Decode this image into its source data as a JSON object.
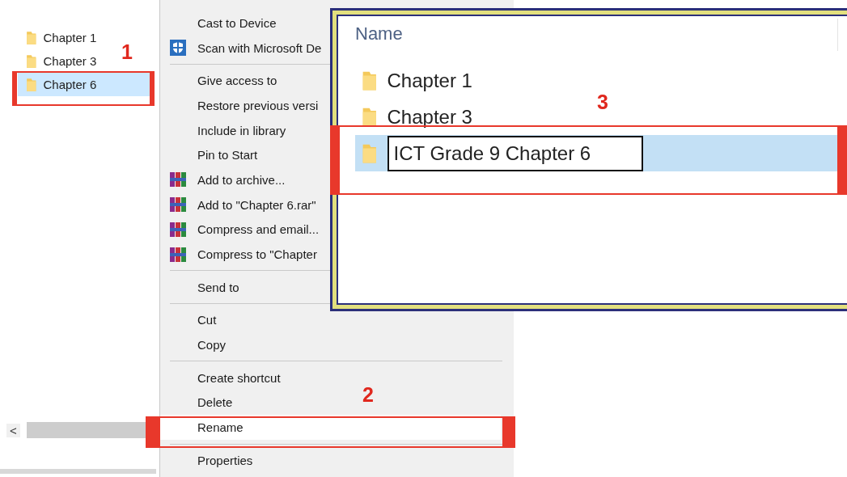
{
  "left_pane": {
    "items": [
      {
        "label": "Chapter 1",
        "selected": false
      },
      {
        "label": "Chapter 3",
        "selected": false
      },
      {
        "label": "Chapter 6",
        "selected": true
      }
    ],
    "scroll_left": "<"
  },
  "context_menu": {
    "items": [
      {
        "kind": "item",
        "label": "Cast to Device"
      },
      {
        "kind": "scan",
        "label": "Scan with Microsoft De"
      },
      {
        "kind": "separator"
      },
      {
        "kind": "item",
        "label": "Give access to"
      },
      {
        "kind": "item",
        "label": "Restore previous versi"
      },
      {
        "kind": "item",
        "label": "Include in library"
      },
      {
        "kind": "item",
        "label": "Pin to Start"
      },
      {
        "kind": "archive",
        "label": "Add to archive..."
      },
      {
        "kind": "archive",
        "label": "Add to \"Chapter 6.rar\""
      },
      {
        "kind": "archive",
        "label": "Compress and email..."
      },
      {
        "kind": "archive",
        "label": "Compress to \"Chapter"
      },
      {
        "kind": "separator"
      },
      {
        "kind": "item",
        "label": "Send to"
      },
      {
        "kind": "separator"
      },
      {
        "kind": "item",
        "label": "Cut"
      },
      {
        "kind": "item",
        "label": "Copy"
      },
      {
        "kind": "separator"
      },
      {
        "kind": "item",
        "label": "Create shortcut"
      },
      {
        "kind": "item",
        "label": "Delete"
      },
      {
        "kind": "item",
        "label": "Rename",
        "highlighted": true
      },
      {
        "kind": "separator"
      },
      {
        "kind": "item",
        "label": "Properties"
      }
    ]
  },
  "zoom_panel": {
    "column_header": "Name",
    "items": [
      {
        "label": "Chapter 1",
        "selected": false
      },
      {
        "label": "Chapter 3",
        "selected": false
      },
      {
        "value": "ICT Grade 9 Chapter 6",
        "selected": true,
        "editing": true
      }
    ]
  },
  "annotations": [
    {
      "label": "1"
    },
    {
      "label": "2"
    },
    {
      "label": "3"
    }
  ]
}
